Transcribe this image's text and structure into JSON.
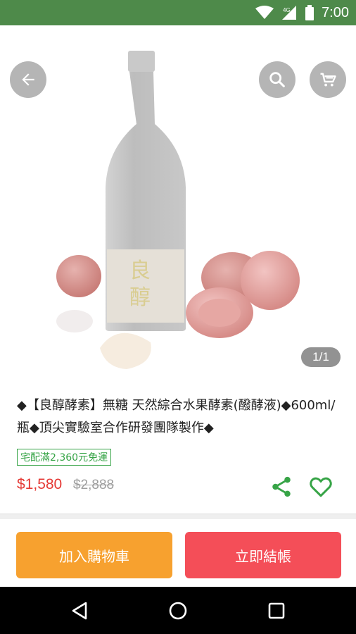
{
  "status_bar": {
    "network": "4G",
    "time": "7:00"
  },
  "header": {
    "back_icon": "arrow-left-icon",
    "search_icon": "search-icon",
    "cart_icon": "shopping-cart-icon"
  },
  "gallery": {
    "indicator": "1/1",
    "label_char_1": "良",
    "label_char_2": "醇"
  },
  "product": {
    "title": "◆【良醇酵素】無糖 天然綜合水果酵素(醱酵液)◆600ml/瓶◆頂尖實驗室合作研發團隊製作◆",
    "shipping_badge": "宅配滿2,360元免運",
    "price": "$1,580",
    "original_price": "$2,888",
    "share_icon": "share-icon",
    "favorite_icon": "heart-outline-icon"
  },
  "actions": {
    "add_to_cart": "加入購物車",
    "checkout": "立即結帳"
  },
  "colors": {
    "status_bar": "#4e8a4a",
    "accent_green": "#37a447",
    "price_red": "#e53935",
    "cart_orange": "#f7a12f",
    "buy_red": "#f44e58"
  },
  "nav": {
    "back_icon": "triangle-back-icon",
    "home_icon": "circle-home-icon",
    "recent_icon": "square-recents-icon"
  }
}
